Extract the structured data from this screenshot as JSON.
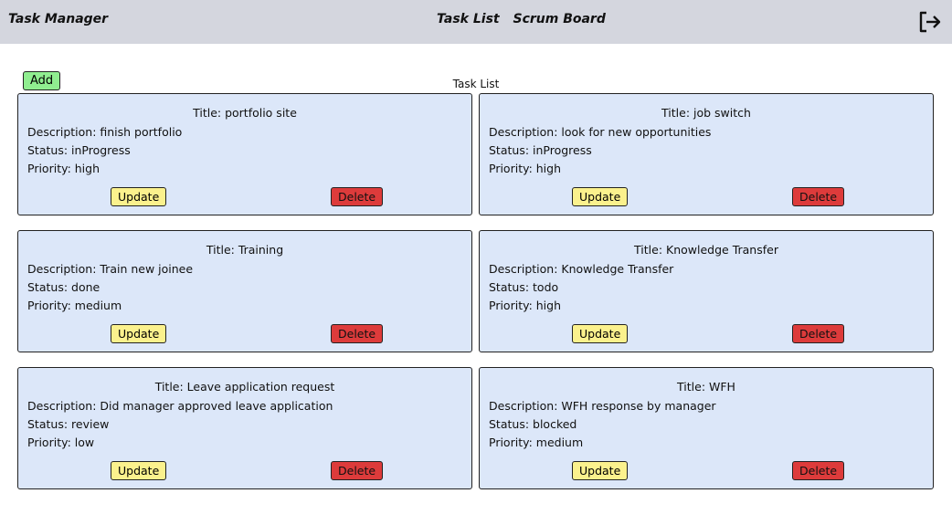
{
  "navbar": {
    "brand": "Task Manager",
    "links": [
      "Task List",
      "Scrum Board"
    ],
    "logout_icon": "logout-icon"
  },
  "toolbar": {
    "add_label": "Add"
  },
  "page": {
    "title": "Task List"
  },
  "tasks": [
    {
      "title": "Title: portfolio site",
      "description": "Description: finish portfolio",
      "status": "Status: inProgress",
      "priority": "Priority: high"
    },
    {
      "title": "Title: job switch",
      "description": "Description: look for new opportunities",
      "status": "Status: inProgress",
      "priority": "Priority: high"
    },
    {
      "title": "Title: Training",
      "description": "Description: Train new joinee",
      "status": "Status: done",
      "priority": "Priority: medium"
    },
    {
      "title": "Title: Knowledge Transfer",
      "description": "Description: Knowledge Transfer",
      "status": "Status: todo",
      "priority": "Priority: high"
    },
    {
      "title": "Title: Leave application request",
      "description": "Description: Did manager approved leave application",
      "status": "Status: review",
      "priority": "Priority: low"
    },
    {
      "title": "Title: WFH",
      "description": "Description: WFH response by manager",
      "status": "Status: blocked",
      "priority": "Priority: medium"
    }
  ],
  "buttons": {
    "update": "Update",
    "delete": "Delete"
  },
  "colors": {
    "navbar": "#d4d6de",
    "card": "#dce7f9",
    "add": "#90ee90",
    "update": "#fbf18d",
    "delete": "#dd3b3b"
  }
}
